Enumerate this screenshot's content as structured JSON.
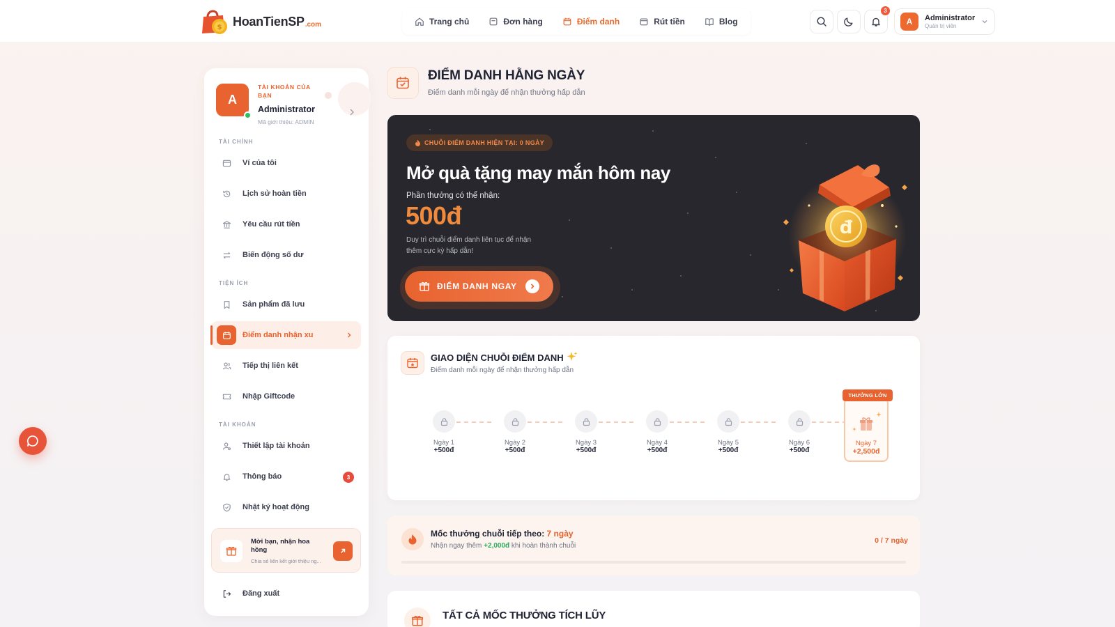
{
  "brand": {
    "name": "HoanTienSP",
    "suffix": ".com"
  },
  "topnav": [
    {
      "label": "Trang chủ",
      "icon": "home-icon"
    },
    {
      "label": "Đơn hàng",
      "icon": "order-icon"
    },
    {
      "label": "Điểm danh",
      "icon": "calendar-icon",
      "active": true
    },
    {
      "label": "Rút tiền",
      "icon": "wallet-icon"
    },
    {
      "label": "Blog",
      "icon": "book-icon"
    }
  ],
  "header": {
    "notification_count": "3",
    "user": {
      "initial": "A",
      "name": "Administrator",
      "role": "Quản trị viên"
    }
  },
  "sidebar": {
    "profile": {
      "initial": "A",
      "kicker": "TÀI KHOẢN CỦA BẠN",
      "name": "Administrator",
      "referral": "Mã giới thiệu: ADMIN"
    },
    "sections": {
      "finance": "TÀI CHÍNH",
      "utilities": "TIỆN ÍCH",
      "account": "TÀI KHOẢN"
    },
    "items": {
      "wallet": "Ví của tôi",
      "cashback_history": "Lịch sử hoàn tiền",
      "withdraw_request": "Yêu cầu rút tiền",
      "balance_changes": "Biến động số dư",
      "saved_products": "Sản phẩm đã lưu",
      "checkin_coins": "Điểm danh nhận xu",
      "affiliate": "Tiếp thị liên kết",
      "giftcode": "Nhập Giftcode",
      "account_settings": "Thiết lập tài khoản",
      "notifications": "Thông báo",
      "activity_log": "Nhật ký hoạt động",
      "logout": "Đăng xuất"
    },
    "notification_badge": "3",
    "invite": {
      "title": "Mời bạn, nhận hoa hồng",
      "subtitle": "Chia sẻ liên kết giới thiệu ng..."
    }
  },
  "page": {
    "title": "ĐIỂM DANH HẰNG NGÀY",
    "subtitle": "Điểm danh mỗi ngày để nhận thưởng hấp dẫn"
  },
  "hero": {
    "streak_label": "CHUỖI ĐIỂM DANH HIỆN TẠI: 0 NGÀY",
    "title": "Mở quà tặng may mắn hôm nay",
    "reward_label": "Phần thưởng có thể nhận:",
    "reward_amount": "500đ",
    "description": "Duy trì chuỗi điểm danh liên tục để nhận thêm cực kỳ hấp dẫn!",
    "button_label": "ĐIỂM DANH NGAY"
  },
  "streak": {
    "title": "GIAO DIỆN CHUỖI ĐIỂM DANH",
    "subtitle": "Điểm danh mỗi ngày để nhận thưởng hấp dẫn",
    "days": [
      {
        "label": "Ngày 1",
        "value": "+500đ"
      },
      {
        "label": "Ngày 2",
        "value": "+500đ"
      },
      {
        "label": "Ngày 3",
        "value": "+500đ"
      },
      {
        "label": "Ngày 4",
        "value": "+500đ"
      },
      {
        "label": "Ngày 5",
        "value": "+500đ"
      },
      {
        "label": "Ngày 6",
        "value": "+500đ"
      }
    ],
    "big_day": {
      "tag": "THƯỞNG LỚN",
      "label": "Ngày 7",
      "value": "+2,500đ"
    }
  },
  "milestone": {
    "title_prefix": "Mốc thưởng chuỗi tiếp theo: ",
    "title_highlight": "7 ngày",
    "sub_prefix": "Nhận ngay thêm ",
    "sub_amount": "+2,000đ",
    "sub_suffix": " khi hoàn thành chuỗi",
    "progress_text": "0 / 7 ngày",
    "progress": 0
  },
  "accumulated": {
    "title": "TẤT CẢ MỐC THƯỞNG TÍCH LŨY"
  },
  "colors": {
    "accent": "#e8632f",
    "dark": "#27272d",
    "success": "#2fbf63"
  }
}
